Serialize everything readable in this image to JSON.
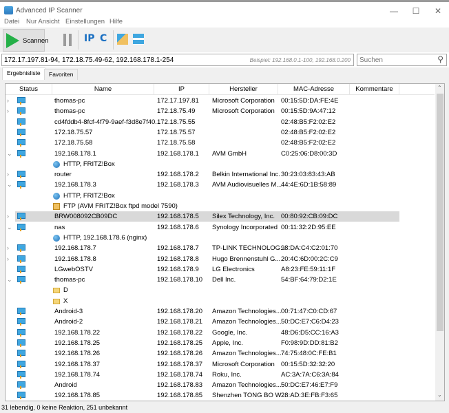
{
  "window": {
    "title": "Advanced IP Scanner",
    "minimize": "—",
    "maximize": "☐",
    "close": "✕"
  },
  "menu": [
    "Datei",
    "Nur Ansicht",
    "Einstellungen",
    "Hilfe"
  ],
  "toolbar": {
    "scan_label": "Scannen",
    "ip_label": "IP",
    "c_label": "C"
  },
  "range": {
    "value": "172.17.197.81-94, 172.18.75.49-62, 192.168.178.1-254",
    "example": "Beispiel: 192.168.0.1-100, 192.168.0.200"
  },
  "search": {
    "placeholder": "Suchen"
  },
  "tabs": [
    "Ergebnisliste",
    "Favoriten"
  ],
  "columns": [
    "Status",
    "Name",
    "IP",
    "Hersteller",
    "MAC-Adresse",
    "Kommentare"
  ],
  "rows": [
    {
      "exp": "›",
      "name": "thomas-pc",
      "ip": "172.17.197.81",
      "vendor": "Microsoft Corporation",
      "mac": "00:15:5D:DA:FE:4E"
    },
    {
      "exp": "›",
      "name": "thomas-pc",
      "ip": "172.18.75.49",
      "vendor": "Microsoft Corporation",
      "mac": "00:15:5D:9A:47:12"
    },
    {
      "exp": "",
      "name": "cd4fddb4-8fcf-4f79-9aef-f3d8e7f40...",
      "ip": "172.18.75.55",
      "vendor": "",
      "mac": "02:48:B5:F2:02:E2"
    },
    {
      "exp": "",
      "name": "172.18.75.57",
      "ip": "172.18.75.57",
      "vendor": "",
      "mac": "02:48:B5:F2:02:E2"
    },
    {
      "exp": "",
      "name": "172.18.75.58",
      "ip": "172.18.75.58",
      "vendor": "",
      "mac": "02:48:B5:F2:02:E2"
    },
    {
      "exp": "⌄",
      "name": "192.168.178.1",
      "ip": "192.168.178.1",
      "vendor": "AVM GmbH",
      "mac": "C0:25:06:D8:00:3D"
    },
    {
      "child": "globe",
      "name": "HTTP, FRITZ!Box"
    },
    {
      "exp": "›",
      "name": "router",
      "ip": "192.168.178.2",
      "vendor": "Belkin International Inc.",
      "mac": "30:23:03:83:43:AB"
    },
    {
      "exp": "⌄",
      "name": "192.168.178.3",
      "ip": "192.168.178.3",
      "vendor": "AVM Audiovisuelles M...",
      "mac": "44:4E:6D:1B:58:89"
    },
    {
      "child": "globe",
      "name": "HTTP, FRITZ!Box"
    },
    {
      "child": "ftp",
      "name": "FTP (AVM FRITZ!Box ftpd model 7590)"
    },
    {
      "exp": "›",
      "name": "BRW008092CB09DC",
      "ip": "192.168.178.5",
      "vendor": "Silex Technology, Inc.",
      "mac": "00:80:92:CB:09:DC",
      "selected": true
    },
    {
      "exp": "⌄",
      "name": "nas",
      "ip": "192.168.178.6",
      "vendor": "Synology Incorporated",
      "mac": "00:11:32:2D:95:EE"
    },
    {
      "child": "globe",
      "name": "HTTP, 192.168.178.6 (nginx)"
    },
    {
      "exp": "›",
      "name": "192.168.178.7",
      "ip": "192.168.178.7",
      "vendor": "TP-LINK TECHNOLOG...",
      "mac": "98:DA:C4:C2:01:70"
    },
    {
      "exp": "›",
      "name": "192.168.178.8",
      "ip": "192.168.178.8",
      "vendor": "Hugo Brennenstuhl G...",
      "mac": "20:4C:6D:00:2C:C9"
    },
    {
      "exp": "",
      "name": "LGwebOSTV",
      "ip": "192.168.178.9",
      "vendor": "LG Electronics",
      "mac": "A8:23:FE:59:11:1F"
    },
    {
      "exp": "⌄",
      "name": "thomas-pc",
      "ip": "192.168.178.10",
      "vendor": "Dell Inc.",
      "mac": "54:BF:64:79:D2:1E"
    },
    {
      "child": "folder",
      "name": "D"
    },
    {
      "child": "folder",
      "name": "X"
    },
    {
      "exp": "",
      "name": "Android-3",
      "ip": "192.168.178.20",
      "vendor": "Amazon Technologies...",
      "mac": "00:71:47:C0:CD:67"
    },
    {
      "exp": "",
      "name": "Android-2",
      "ip": "192.168.178.21",
      "vendor": "Amazon Technologies...",
      "mac": "50:DC:E7:C6:D4:23"
    },
    {
      "exp": "",
      "name": "192.168.178.22",
      "ip": "192.168.178.22",
      "vendor": "Google, Inc.",
      "mac": "48:D6:D5:CC:16:A3"
    },
    {
      "exp": "",
      "name": "192.168.178.25",
      "ip": "192.168.178.25",
      "vendor": "Apple, Inc.",
      "mac": "F0:98:9D:DD:81:B2"
    },
    {
      "exp": "",
      "name": "192.168.178.26",
      "ip": "192.168.178.26",
      "vendor": "Amazon Technologies...",
      "mac": "74:75:48:0C:FE:B1"
    },
    {
      "exp": "",
      "name": "192.168.178.37",
      "ip": "192.168.178.37",
      "vendor": "Microsoft Corporation",
      "mac": "00:15:5D:32:32:20"
    },
    {
      "exp": "",
      "name": "192.168.178.74",
      "ip": "192.168.178.74",
      "vendor": "Roku, Inc.",
      "mac": "AC:3A:7A:C6:3A:84"
    },
    {
      "exp": "",
      "name": "Android",
      "ip": "192.168.178.83",
      "vendor": "Amazon Technologies...",
      "mac": "50:DC:E7:46:E7:F9"
    },
    {
      "exp": "",
      "name": "192.168.178.85",
      "ip": "192.168.178.85",
      "vendor": "Shenzhen TONG BO W...",
      "mac": "28:AD:3E:FB:F3:65"
    }
  ],
  "status": "31 lebendig, 0 keine Reaktion, 251 unbekannt",
  "colors": {
    "scan_green": "#25b048",
    "selection": "#d9d9d9",
    "icon_blue": "#1a6fc2"
  }
}
